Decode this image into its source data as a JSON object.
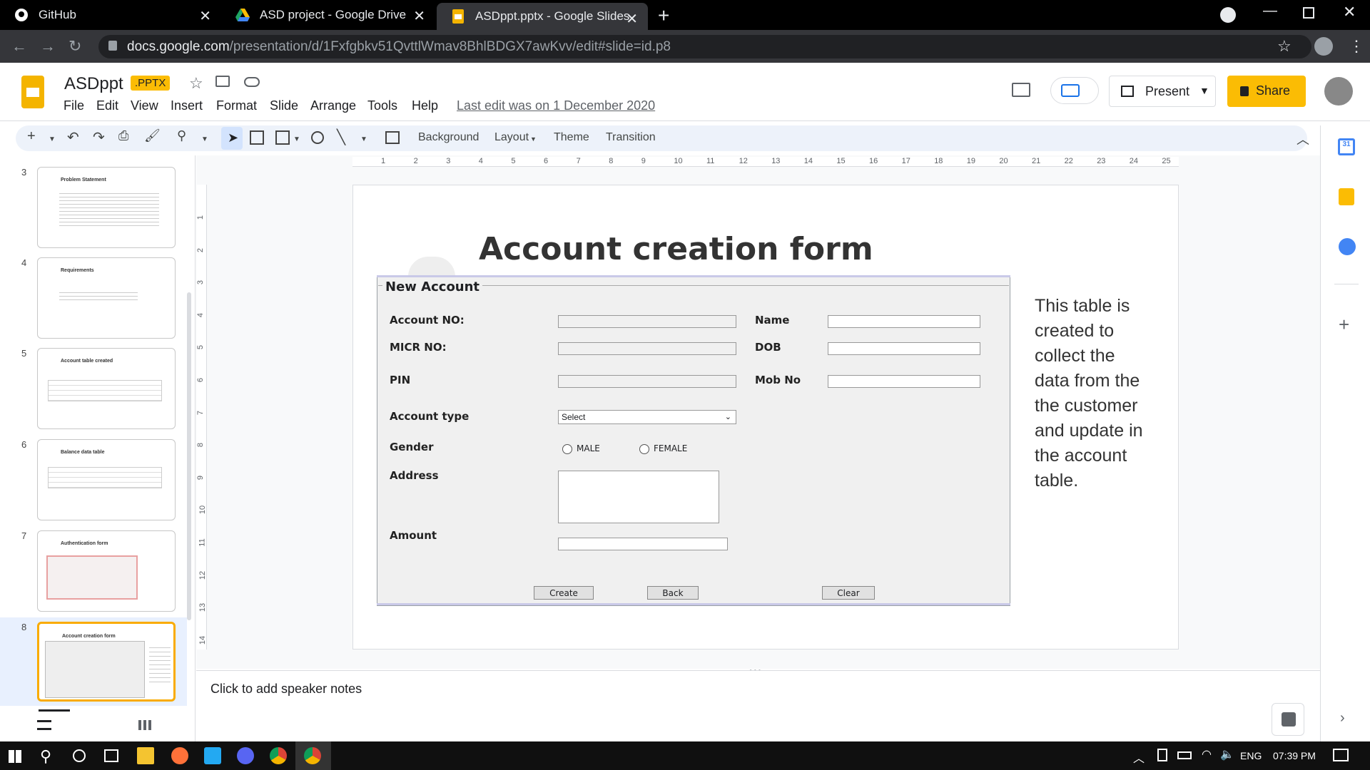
{
  "browser": {
    "tabs": [
      {
        "title": "GitHub"
      },
      {
        "title": "ASD project - Google Drive"
      },
      {
        "title": "ASDppt.pptx - Google Slides"
      }
    ],
    "url_host": "docs.google.com",
    "url_path": "/presentation/d/1Fxfgbkv51QvttlWmav8BhlBDGX7awKvv/edit#slide=id.p8"
  },
  "doc": {
    "title": "ASDppt",
    "badge": ".PPTX",
    "menus": [
      "File",
      "Edit",
      "View",
      "Insert",
      "Format",
      "Slide",
      "Arrange",
      "Tools",
      "Help"
    ],
    "last_edit": "Last edit was on 1 December 2020",
    "present_label": "Present",
    "share_label": "Share"
  },
  "toolbar": {
    "background": "Background",
    "layout": "Layout",
    "theme": "Theme",
    "transition": "Transition"
  },
  "ruler": [
    "1",
    "2",
    "3",
    "4",
    "5",
    "6",
    "7",
    "8",
    "9",
    "10",
    "11",
    "12",
    "13",
    "14",
    "15",
    "16",
    "17",
    "18",
    "19",
    "20",
    "21",
    "22",
    "23",
    "24",
    "25"
  ],
  "vruler": [
    "1",
    "2",
    "3",
    "4",
    "5",
    "6",
    "7",
    "8",
    "9",
    "10",
    "11",
    "12",
    "13",
    "14"
  ],
  "thumbnails": [
    {
      "num": "3",
      "title": "Problem Statement"
    },
    {
      "num": "4",
      "title": "Requirements"
    },
    {
      "num": "5",
      "title": "Account table created"
    },
    {
      "num": "6",
      "title": "Balance data table"
    },
    {
      "num": "7",
      "title": "Authentication form"
    },
    {
      "num": "8",
      "title": "Account creation form"
    }
  ],
  "slide": {
    "title": "Account creation form",
    "form_title": "New Account",
    "labels": {
      "account_no": "Account NO:",
      "micr": "MICR NO:",
      "pin": "PIN",
      "account_type": "Account type",
      "gender": "Gender",
      "address": "Address",
      "amount": "Amount",
      "name": "Name",
      "dob": "DOB",
      "mob": "Mob No"
    },
    "select_value": "Select",
    "radio_male": "MALE",
    "radio_female": "FEMALE",
    "buttons": {
      "create": "Create",
      "back": "Back",
      "clear": "Clear"
    },
    "side_text": "This table is created to collect  the data from the the customer and update in the account table."
  },
  "notes_placeholder": "Click to add speaker notes",
  "taskbar": {
    "lang": "ENG",
    "time": "07:39 PM"
  },
  "colors": {
    "accent": "#fbbc04",
    "slides_yellow": "#f4b400",
    "active_thumb": "#f9ab00"
  }
}
